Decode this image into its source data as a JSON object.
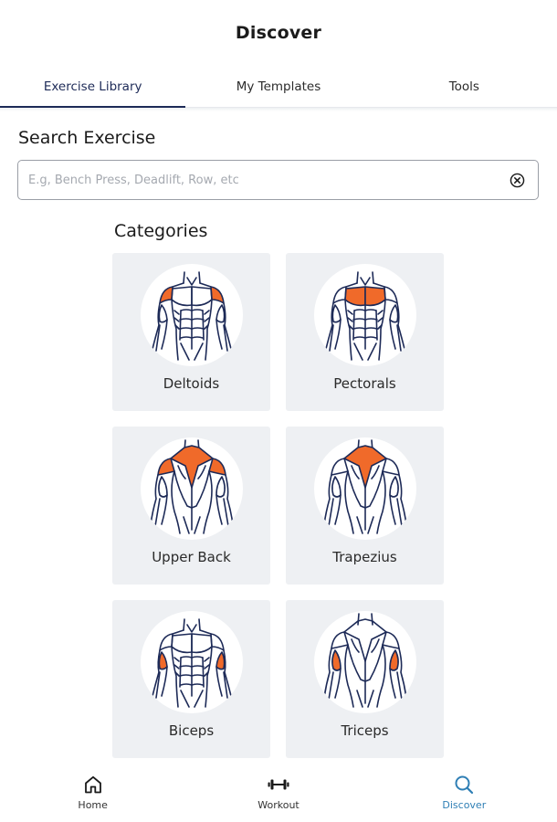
{
  "header": {
    "title": "Discover"
  },
  "tabs": [
    {
      "label": "Exercise Library",
      "active": true
    },
    {
      "label": "My Templates",
      "active": false
    },
    {
      "label": "Tools",
      "active": false
    }
  ],
  "search": {
    "title": "Search Exercise",
    "placeholder": "E.g, Bench Press, Deadlift, Row, etc",
    "value": ""
  },
  "categories": {
    "title": "Categories",
    "items": [
      {
        "label": "Deltoids",
        "view": "front",
        "highlight": "deltoids"
      },
      {
        "label": "Pectorals",
        "view": "front",
        "highlight": "pectorals"
      },
      {
        "label": "Upper Back",
        "view": "back",
        "highlight": "upper-back"
      },
      {
        "label": "Trapezius",
        "view": "back",
        "highlight": "trapezius"
      },
      {
        "label": "Biceps",
        "view": "front",
        "highlight": "biceps"
      },
      {
        "label": "Triceps",
        "view": "back",
        "highlight": "triceps"
      }
    ]
  },
  "bottom_nav": [
    {
      "label": "Home",
      "icon": "home-icon",
      "active": false
    },
    {
      "label": "Workout",
      "icon": "dumbbell-icon",
      "active": false
    },
    {
      "label": "Discover",
      "icon": "search-icon",
      "active": true
    }
  ],
  "colors": {
    "navy": "#1d2a57",
    "muscle_highlight": "#f06a2a",
    "card_bg": "#eef0f3",
    "active_nav": "#2f7fb5"
  }
}
